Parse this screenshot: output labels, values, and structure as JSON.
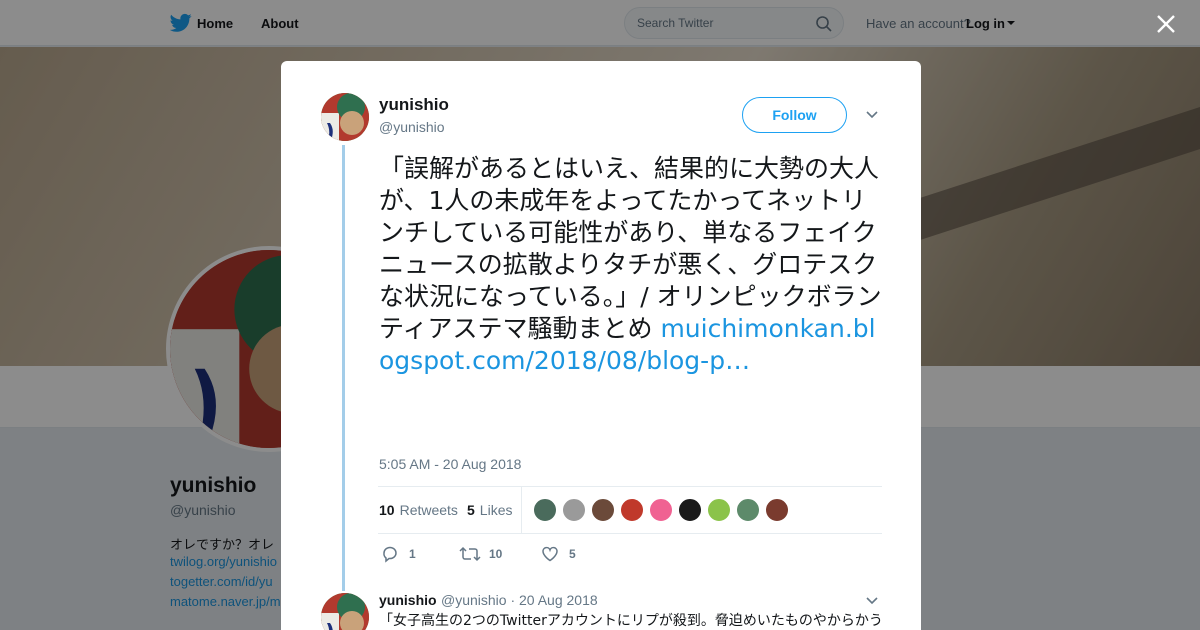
{
  "nav": {
    "home_label": "Home",
    "about_label": "About",
    "search_placeholder": "Search Twitter",
    "have_account": "Have an account?",
    "login_label": "Log in"
  },
  "background_profile": {
    "name": "yunishio",
    "handle": "@yunishio",
    "bio": "オレですか？オレ",
    "links": [
      "twilog.org/yunishio",
      "togetter.com/id/yu",
      "matome.naver.jp/m"
    ]
  },
  "tweet": {
    "author_name": "yunishio",
    "author_handle": "@yunishio",
    "follow_label": "Follow",
    "text": "「誤解があるとはいえ、結果的に大勢の大人が、1人の未成年をよってたかってネットリンチしている可能性があり、単なるフェイクニュースの拡散よりタチが悪く、グロテスクな状況になっている。」/ オリンピックボランティアステマ騒動まとめ ",
    "link_text": "muichimonkan.blogspot.com/2018/08/blog-p…",
    "timestamp": "5:05 AM - 20 Aug 2018",
    "retweets_count": "10",
    "retweets_label": "Retweets",
    "likes_count": "5",
    "likes_label": "Likes",
    "reply_action_count": "1",
    "retweet_action_count": "10",
    "like_action_count": "5"
  },
  "likers": [
    {
      "color": "#4a6b5c"
    },
    {
      "color": "#9a9a9a"
    },
    {
      "color": "#6b4a3a"
    },
    {
      "color": "#c0392b"
    },
    {
      "color": "#f06292"
    },
    {
      "color": "#1a1a1a"
    },
    {
      "color": "#8bc34a"
    },
    {
      "color": "#5d8a6a"
    },
    {
      "color": "#7a3b2e"
    }
  ],
  "reply": {
    "author_name": "yunishio",
    "meta": "@yunishio · 20 Aug 2018",
    "text": "「女子高生の2つのTwitterアカウントにリプが殺到。脅迫めいたものやからかう"
  },
  "colors": {
    "twitter_blue": "#1da1f2",
    "link_blue": "#1b95e0",
    "thread_line": "#a3cde9"
  }
}
